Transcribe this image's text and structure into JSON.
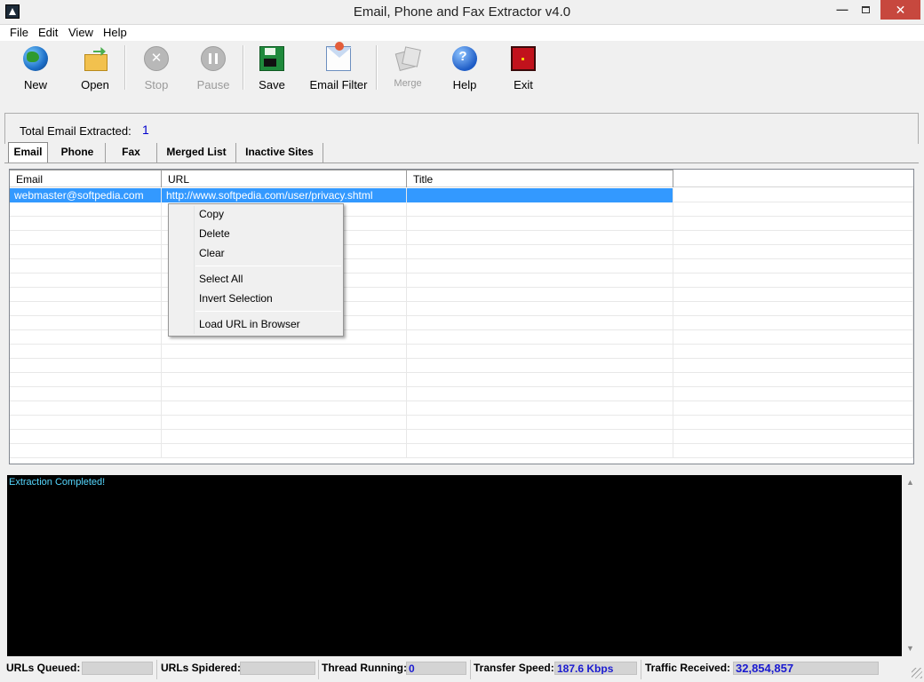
{
  "window": {
    "title": "Email, Phone and Fax Extractor v4.0",
    "minimize": "—",
    "close": "✕"
  },
  "menu": [
    "File",
    "Edit",
    "View",
    "Help"
  ],
  "toolbar": {
    "new": "New",
    "open": "Open",
    "stop": "Stop",
    "pause": "Pause",
    "save": "Save",
    "email_filter": "Email Filter",
    "merge": "Merge",
    "help": "Help",
    "exit": "Exit"
  },
  "summary": {
    "label": "Total Email Extracted:",
    "value": "1"
  },
  "tabs": [
    "Email",
    "Phone",
    "Fax",
    "Merged List",
    "Inactive Sites"
  ],
  "table": {
    "columns": [
      "Email",
      "URL",
      "Title"
    ],
    "rows": [
      [
        "webmaster@softpedia.com",
        "http://www.softpedia.com/user/privacy.shtml",
        ""
      ]
    ]
  },
  "context_menu": [
    "Copy",
    "Delete",
    "Clear",
    "Select All",
    "Invert Selection",
    "Load URL in Browser"
  ],
  "log": {
    "text": "Extraction Completed!"
  },
  "status": {
    "urls_queued_label": "URLs Queued:",
    "urls_queued_value": "",
    "urls_spidered_label": "URLs Spidered:",
    "urls_spidered_value": "",
    "thread_running_label": "Thread Running:",
    "thread_running_value": "0",
    "transfer_speed_label": "Transfer Speed:",
    "transfer_speed_value": "187.6 Kbps",
    "traffic_received_label": "Traffic Received:",
    "traffic_received_value": "32,854,857"
  },
  "colors": {
    "selection": "#3399ff",
    "log_text": "#56d8ff",
    "status_value": "#1a1ad0",
    "close_button": "#c7483e"
  }
}
